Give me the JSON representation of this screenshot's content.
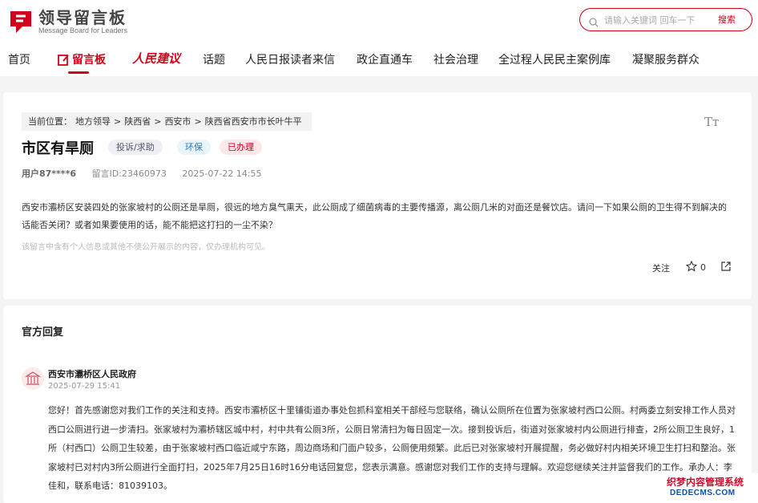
{
  "logo": {
    "title": "领导留言板",
    "subtitle": "Message Board for Leaders"
  },
  "search": {
    "placeholder": "请输入关键词 回车一下",
    "button_label": "搜索"
  },
  "nav": [
    {
      "label": "首页"
    },
    {
      "label": "留言板"
    },
    {
      "label": "人民建议"
    },
    {
      "label": "话题"
    },
    {
      "label": "人民日报读者来信"
    },
    {
      "label": "政企直通车"
    },
    {
      "label": "社会治理"
    },
    {
      "label": "全过程人民民主案例库"
    },
    {
      "label": "凝聚服务群众"
    }
  ],
  "message": {
    "breadcrumb": [
      "当前位置：",
      "地方领导",
      ">",
      "陕西省",
      ">",
      "西安市",
      ">",
      "陕西省西安市市长叶牛平"
    ],
    "fontsize_label": "Tт",
    "title": "市区有旱厕",
    "tags": [
      "投诉/求助",
      "环保",
      "已办理"
    ],
    "user": "用户87****6",
    "message_id": "留言ID:23460973",
    "time": "2025-07-22 14:55",
    "body": "西安市灞桥区安装四处的张家坡村的公厕还是旱厕，很远的地方臭气熏天，此公厕成了细菌病毒的主要传播源，离公厕几米的对面还是餐饮店。请问一下如果公厕的卫生得不到解决的话能否关闭？或者如果要使用的话，能不能把这打扫的一尘不染？",
    "note": "该留言中含有个人信息或其他不便公开展示的内容，仅办理机构可见。",
    "follow_label": "关注",
    "like_count": "0"
  },
  "reply": {
    "heading": "官方回复",
    "org": "西安市灞桥区人民政府",
    "time": "2025-07-29 15:41",
    "body": "您好！首先感谢您对我们工作的关注和支持。西安市灞桥区十里铺街道办事处包抓科室相关干部经与您联络，确认公厕所在位置为张家坡村西口公厕。村两委立刻安排工作人员对西口公厕进行进一步清扫。张家坡村为灞桥辖区城中村，村中共有公厕3所，公厕日常清扫为每日固定一次。接到投诉后，街道对张家坡村内公厕进行排查，2所公厕卫生良好，1所（村西口）公厕卫生较差，由于张家坡村西口临近咸宁东路，周边商场和门面户较多，公厕使用频繁。此后已对张家坡村开展提醒，务必做好村内相关环境卫生打扫和整治。张家坡村已对村内3所公厕进行全面打扫，2025年7月25日16时16分电话回复您，您表示满意。感谢您对我们工作的支持与理解。欢迎您继续关注并监督我们的工作。承办人：李佳和，联系电话：81039103。"
  },
  "watermark": {
    "line1": "织梦内容管理系统",
    "line2": "DEDECMS.COM"
  },
  "colors": {
    "accent": "#d0021b",
    "env_tag": "#2b7bb9"
  },
  "icons": [
    "logo-mark-icon",
    "search-icon",
    "edit-icon",
    "star-icon",
    "share-icon",
    "government-building-icon"
  ]
}
